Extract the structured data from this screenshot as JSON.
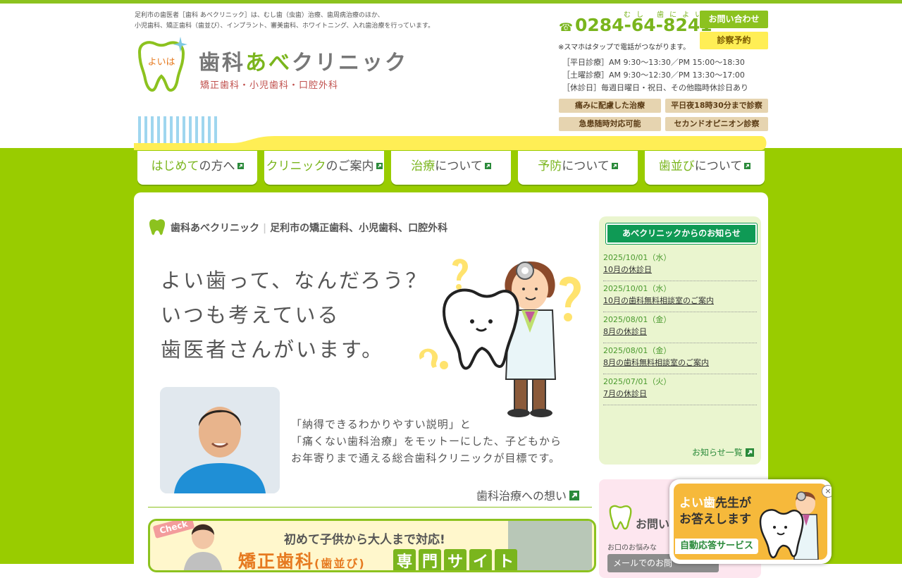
{
  "header": {
    "intro_line1": "足利市の歯医者［歯科 あべクリニック］は、むし歯（虫歯）治療、歯周病治療のほか、",
    "intro_line2": "小児歯科、矯正歯科（歯並び）、インプラント、審美歯科、ホワイトニング、入れ歯治療を行っています。",
    "logo_badge": "よいは",
    "logo_name_a": "歯科",
    "logo_name_b": "あべ",
    "logo_name_c": "クリニック",
    "logo_sub": "矯正歯科・小児歯科・口腔外科",
    "phone_ruby": "むし 歯によい",
    "phone_icon": "☎",
    "phone": "0284-64-8241",
    "phone_note": "※スマホはタップで電話がつながります。",
    "contact_button": "お問い合わせ",
    "reserve_button": "診察予約",
    "hours": [
      "［平日診療］AM 9:30～13:30／PM 15:00～18:30",
      "［土曜診療］AM 9:30～12:30／PM 13:30～17:00",
      "［休診日］毎週日曜日・祝日、その他臨時休診日あり"
    ],
    "features": [
      "痛みに配慮した治療",
      "平日夜18時30分まで診察",
      "急患随時対応可能",
      "セカンドオピニオン診察"
    ]
  },
  "nav": [
    {
      "g": "はじめて",
      "t": "の方へ"
    },
    {
      "g": "クリニック",
      "t": "のご案内"
    },
    {
      "g": "治療",
      "t": "について"
    },
    {
      "g": "予防",
      "t": "について"
    },
    {
      "g": "歯並び",
      "t": "について"
    }
  ],
  "main": {
    "site_name": "歯科あべクリニック",
    "site_desc": "足利市の矯正歯科、小児歯科、口腔外科",
    "hero_lines": [
      "よい歯って、なんだろう？",
      "いつも考えている",
      "歯医者さんがいます。"
    ],
    "message_lines": [
      "「納得できるわかりやすい説明」と",
      "「痛くない歯科治療」をモットーにした、子どもから",
      "お年寄りまで通える総合歯科クリニックが目標です。"
    ],
    "thoughts_link": "歯科治療への想い",
    "banner_check": "Check",
    "banner_top": "初めて子供から大人まで対応!",
    "banner_main": "矯正歯科",
    "banner_main_small": "(歯並び)",
    "banner_site": [
      "専",
      "門",
      "サ",
      "イ",
      "ト"
    ]
  },
  "news": {
    "title": "あべクリニックからのお知らせ",
    "items": [
      {
        "date": "2025/10/01（水）",
        "title": "10月の休診日"
      },
      {
        "date": "2025/10/01（水）",
        "title": "10月の歯科無料相談室のご案内"
      },
      {
        "date": "2025/08/01（金）",
        "title": "8月の休診日"
      },
      {
        "date": "2025/08/01（金）",
        "title": "8月の歯科無料相談室のご案内"
      },
      {
        "date": "2025/07/01（火）",
        "title": "7月の休診日"
      }
    ],
    "more": "お知らせ一覧"
  },
  "contact_card": {
    "title": "お問い",
    "text": "お口のお悩みな",
    "button": "メールでのお問"
  },
  "chat": {
    "line1a": "よい歯",
    "line1b": "先生が",
    "line2": "お答えします",
    "sub": "自動応答サービス",
    "close": "×"
  },
  "colors": {
    "brand_green": "#8cc21f",
    "nav_green": "#99cc00",
    "news_green": "#0f9a55",
    "accent_yellow": "#ffee55"
  }
}
